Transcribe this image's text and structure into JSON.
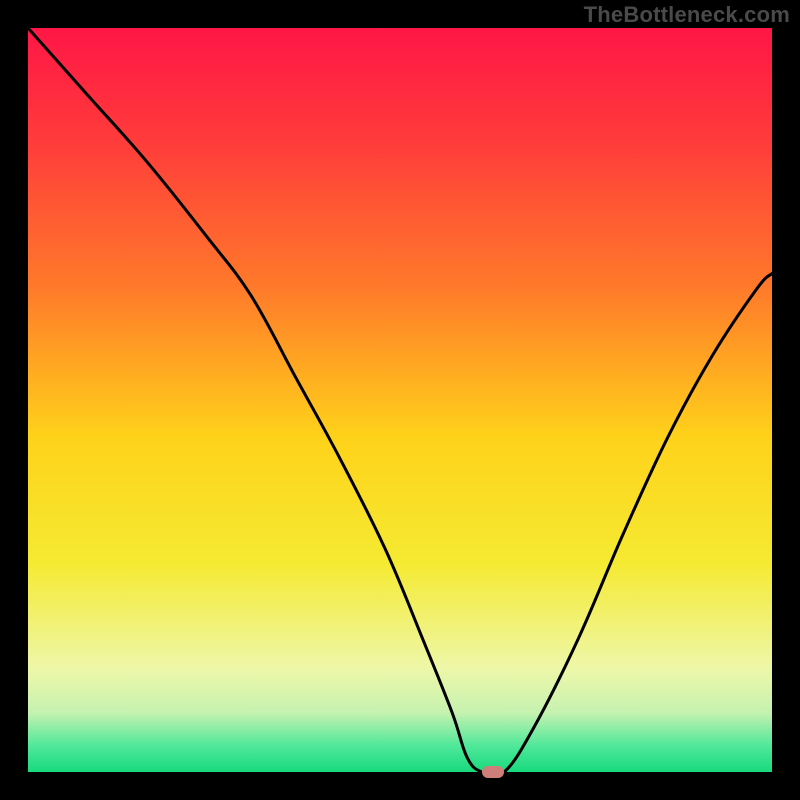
{
  "watermark": "TheBottleneck.com",
  "colors": {
    "frame": "#000000",
    "watermark": "#4a4a4a",
    "curve": "#000000",
    "marker": "#cf7f79",
    "gradient_stops": [
      {
        "offset": 0.0,
        "color": "#ff1646"
      },
      {
        "offset": 0.15,
        "color": "#ff3b3b"
      },
      {
        "offset": 0.35,
        "color": "#ff7a2a"
      },
      {
        "offset": 0.55,
        "color": "#ffd21a"
      },
      {
        "offset": 0.72,
        "color": "#f5ea32"
      },
      {
        "offset": 0.86,
        "color": "#eef7a8"
      },
      {
        "offset": 0.92,
        "color": "#c6f2b0"
      },
      {
        "offset": 0.965,
        "color": "#4fe89a"
      },
      {
        "offset": 1.0,
        "color": "#18d97d"
      }
    ]
  },
  "chart_data": {
    "type": "line",
    "title": "",
    "xlabel": "",
    "ylabel": "",
    "xlim": [
      0,
      100
    ],
    "ylim": [
      0,
      100
    ],
    "grid": false,
    "legend": false,
    "series": [
      {
        "name": "bottleneck-curve",
        "x": [
          0,
          8,
          16,
          24,
          30,
          36,
          42,
          48,
          53,
          57,
          59,
          61,
          64,
          68,
          74,
          80,
          86,
          92,
          98,
          100
        ],
        "values": [
          100,
          91,
          82,
          72,
          64,
          53,
          42,
          30,
          18,
          8,
          2,
          0,
          0,
          6,
          18,
          32,
          45,
          56,
          65,
          67
        ]
      }
    ],
    "annotations": [
      {
        "name": "minimum-marker",
        "x": 62.5,
        "y": 0
      }
    ]
  }
}
